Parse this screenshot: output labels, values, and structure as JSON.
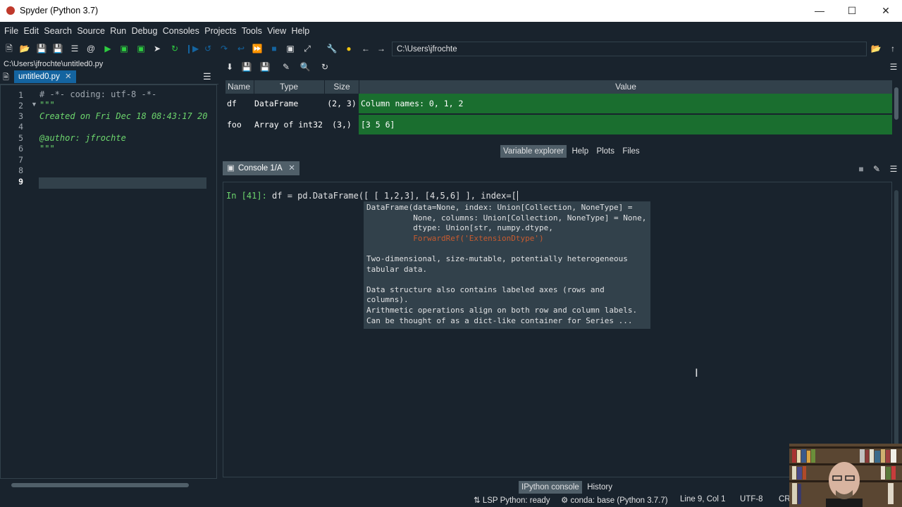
{
  "window": {
    "title": "Spyder (Python 3.7)",
    "controls": [
      "minimize",
      "maximize",
      "close"
    ]
  },
  "menubar": [
    "File",
    "Edit",
    "Search",
    "Source",
    "Run",
    "Debug",
    "Consoles",
    "Projects",
    "Tools",
    "View",
    "Help"
  ],
  "toolbar": {
    "path": "C:\\Users\\jfrochte"
  },
  "editor": {
    "file_path": "C:\\Users\\jfrochte\\untitled0.py",
    "tab_label": "untitled0.py",
    "line_numbers": [
      "1",
      "2",
      "3",
      "4",
      "5",
      "6",
      "7",
      "8",
      "9"
    ],
    "lines": [
      "# -*- coding: utf-8 -*-",
      "\"\"\"",
      "Created on Fri Dec 18 08:43:17 20",
      "",
      "@author: jfrochte",
      "\"\"\"",
      "",
      "",
      ""
    ],
    "current_line": "9"
  },
  "variable_explorer": {
    "columns": [
      "Name",
      "Type",
      "Size",
      "Value"
    ],
    "rows": [
      {
        "name": "df",
        "type": "DataFrame",
        "size": "(2, 3)",
        "value": "Column names: 0, 1, 2"
      },
      {
        "name": "foo",
        "type": "Array of int32",
        "size": "(3,)",
        "value": "[3 5 6]"
      }
    ],
    "tabs": [
      "Variable explorer",
      "Help",
      "Plots",
      "Files"
    ],
    "active_tab": "Variable explorer"
  },
  "console": {
    "tab_label": "Console 1/A",
    "prompt": "In [41]: ",
    "input": "df = pd.DataFrame([ [ 1,2,3], [4,5,6] ], index=[",
    "calltip": {
      "signature_name": "DataFrame",
      "signature_lines": [
        "(data=None, index: Union[Collection, NoneType] =",
        "          None, columns: Union[Collection, NoneType] = None,",
        "          dtype: Union[str, numpy.dtype,",
        "          ForwardRef('ExtensionDtype')"
      ],
      "doc_lines": [
        "",
        "Two-dimensional, size-mutable, potentially heterogeneous",
        "tabular data.",
        "",
        "Data structure also contains labeled axes (rows and",
        "columns).",
        "Arithmetic operations align on both row and column labels.",
        "Can be thought of as a dict-like container for Series ..."
      ]
    },
    "bottom_tabs": [
      "IPython console",
      "History"
    ],
    "active_bottom_tab": "IPython console"
  },
  "statusbar": {
    "lsp": "LSP Python: ready",
    "conda": "conda: base (Python 3.7.7)",
    "position": "Line 9, Col 1",
    "encoding": "UTF-8",
    "eol": "CR"
  },
  "colors": {
    "background": "#19232d",
    "accent": "#1464a0",
    "ve_row": "#1a6e2f",
    "prompt": "#6dd66d"
  }
}
